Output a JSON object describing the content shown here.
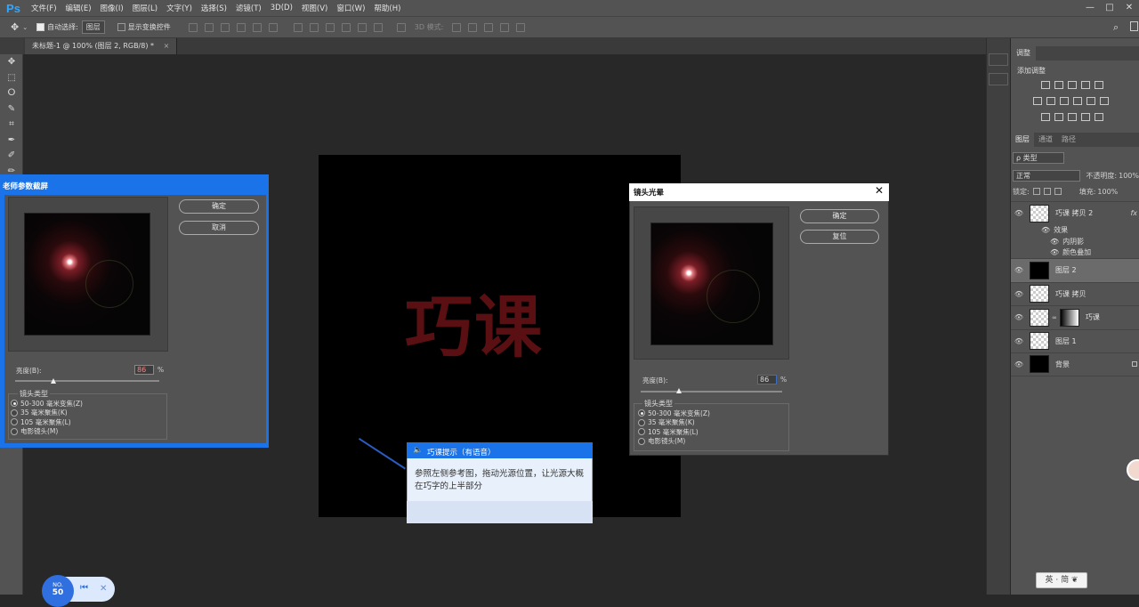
{
  "app": {
    "logo": "Ps"
  },
  "menu": [
    "文件(F)",
    "编辑(E)",
    "图像(I)",
    "图层(L)",
    "文字(Y)",
    "选择(S)",
    "滤镜(T)",
    "3D(D)",
    "视图(V)",
    "窗口(W)",
    "帮助(H)"
  ],
  "window_controls": {
    "minimize": "—",
    "restore": "□",
    "close": "✕"
  },
  "options": {
    "auto_select_label": "自动选择:",
    "auto_select_value": "图层",
    "show_transform_label": "显示变换控件",
    "mode_3d_label": "3D 模式:"
  },
  "document": {
    "tab_title": "未标题-1 @ 100% (图层 2, RGB/8) *",
    "close": "×",
    "canvas_text": "巧课"
  },
  "tools": [
    "✥",
    "⬚",
    "ⵔ",
    "✎",
    "⌗",
    "✒",
    "✐",
    "✏"
  ],
  "panels": {
    "adjust_tab": "调整",
    "adjust_title": "添加调整",
    "layer_tabs": [
      "图层",
      "通道",
      "路径"
    ],
    "filter_type": "ρ 类型",
    "blend_mode": "正常",
    "opacity_label": "不透明度:",
    "opacity_value": "100%",
    "lock_label": "锁定:",
    "fill_label": "填充:",
    "fill_value": "100%",
    "fx": "fx"
  },
  "layers": [
    {
      "name": "巧课 拷贝 2",
      "type": "checker",
      "selected": false,
      "fx": true
    },
    {
      "name": "图层 2",
      "type": "black",
      "selected": true
    },
    {
      "name": "巧课 拷贝",
      "type": "checker",
      "selected": false
    },
    {
      "name": "巧课",
      "type": "mask",
      "selected": false
    },
    {
      "name": "图层 1",
      "type": "checker",
      "selected": false
    },
    {
      "name": "背景",
      "type": "black",
      "selected": false,
      "locked": true
    }
  ],
  "effects": {
    "label": "效果",
    "items": [
      "内阴影",
      "颜色叠加"
    ]
  },
  "teacher_dialog": {
    "title": "老师参数截屏",
    "ok": "确定",
    "cancel": "取消",
    "brightness_label": "亮度(B):",
    "brightness_value": "86",
    "percent": "%",
    "lens_type_label": "镜头类型",
    "lens_options": [
      "50-300 毫米变焦(Z)",
      "35 毫米聚焦(K)",
      "105 毫米聚焦(L)",
      "电影镜头(M)"
    ],
    "selected_lens": 0
  },
  "flare_dialog": {
    "title": "镜头光晕",
    "close": "✕",
    "ok": "确定",
    "reset": "复位",
    "brightness_label": "亮度(B):",
    "brightness_value": "86",
    "percent": "%",
    "lens_type_label": "镜头类型",
    "lens_options": [
      "50-300 毫米变焦(Z)",
      "35 毫米聚焦(K)",
      "105 毫米聚焦(L)",
      "电影镜头(M)"
    ],
    "selected_lens": 0
  },
  "tip": {
    "title": "巧课提示（有语音）",
    "text": "参照左侧参考图，拖动光源位置，让光源大概在巧字的上半部分"
  },
  "player": {
    "no_label": "NO.",
    "number": "50"
  },
  "ime": {
    "text": "英 · 简 ❦"
  }
}
